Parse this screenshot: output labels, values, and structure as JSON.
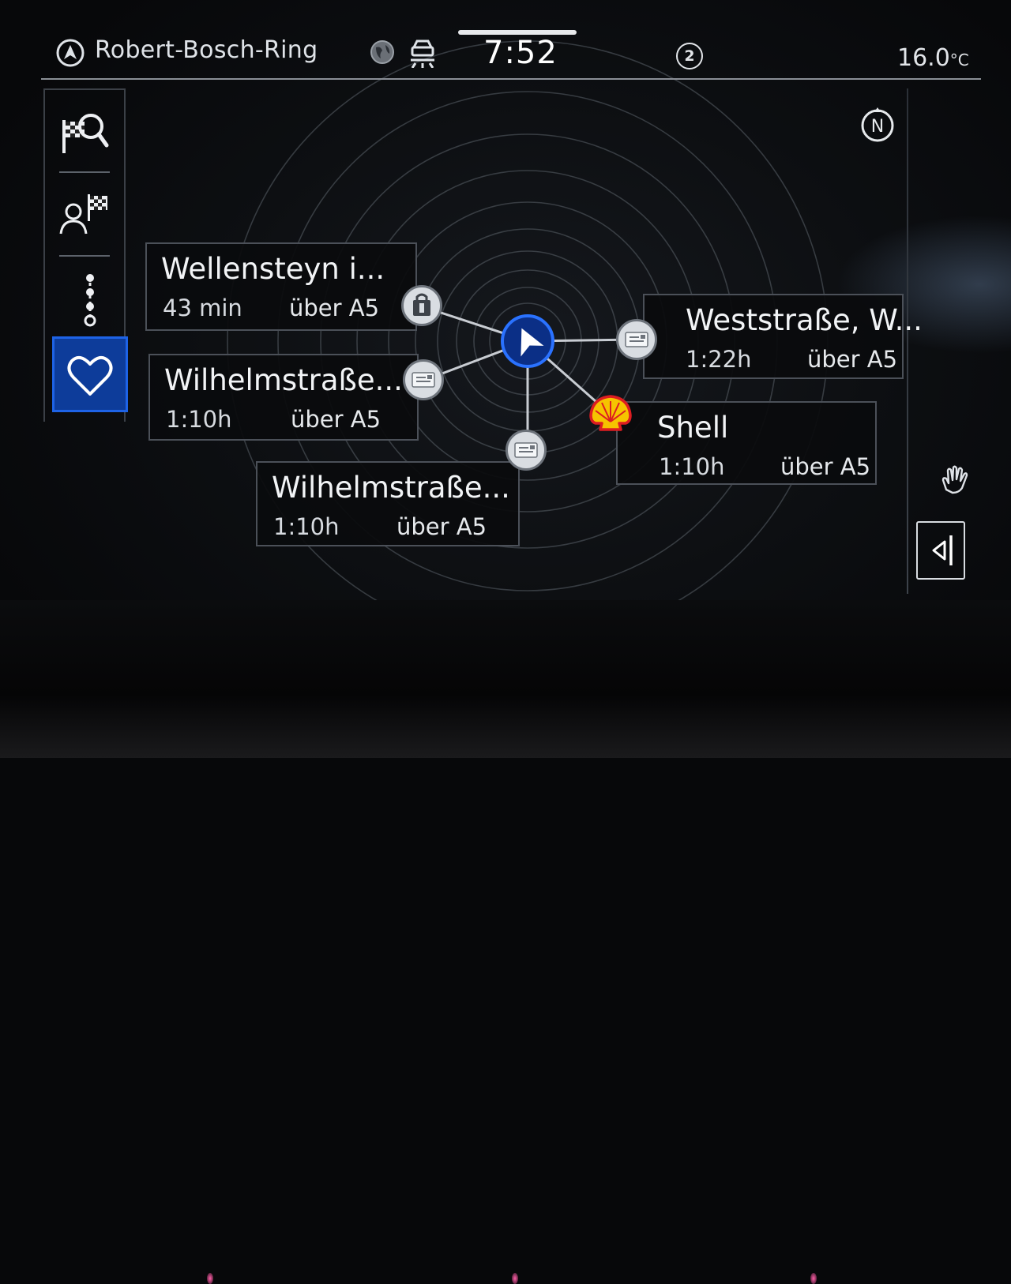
{
  "status_bar": {
    "location": "Robert-Bosch-Ring",
    "time": "7:52",
    "badge_count": "2",
    "temperature": "16.0",
    "temperature_unit": "°C"
  },
  "sidebar": {
    "items": [
      {
        "name": "destination-search",
        "icon": "flag-search-icon"
      },
      {
        "name": "contacts-destination",
        "icon": "person-flag-icon"
      },
      {
        "name": "route-stops",
        "icon": "route-stops-icon"
      },
      {
        "name": "favorites",
        "icon": "heart-icon",
        "active": true
      }
    ]
  },
  "compass_label": "N",
  "colors": {
    "accent": "#0d3c9a",
    "accent_border": "#1e63e6",
    "shell_yellow": "#f6c400",
    "shell_red": "#dd1d21"
  },
  "destinations": [
    {
      "title": "Wellensteyn i...",
      "time": "43 min",
      "route": "über A5",
      "icon": "shopping-bag-icon"
    },
    {
      "title": "Wilhelmstraße...",
      "time": "1:10h",
      "route": "über A5",
      "icon": "address-card-icon"
    },
    {
      "title": "Wilhelmstraße...",
      "time": "1:10h",
      "route": "über A5",
      "icon": "address-card-icon"
    },
    {
      "title": "Weststraße, W...",
      "time": "1:22h",
      "route": "über A5",
      "icon": "address-card-icon"
    },
    {
      "title": "Shell",
      "time": "1:10h",
      "route": "über A5",
      "icon": "shell-logo-icon"
    }
  ]
}
